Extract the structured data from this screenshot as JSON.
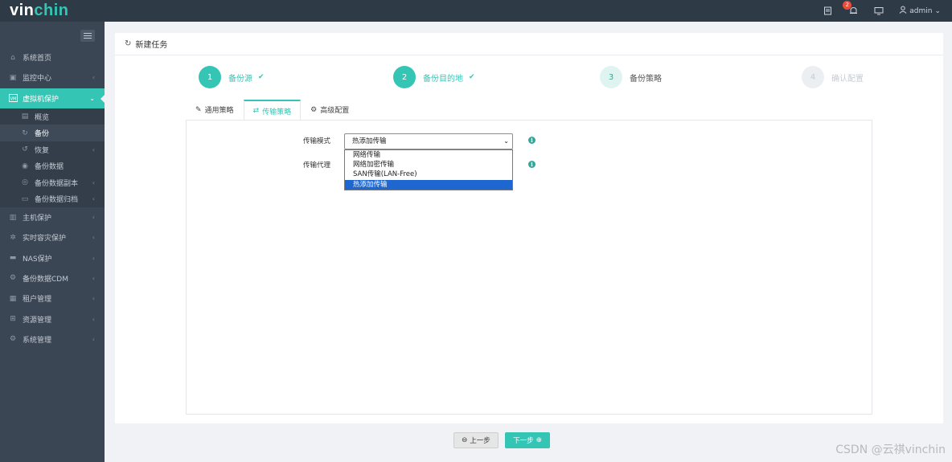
{
  "brand": {
    "part1": "vin",
    "part2": "chin"
  },
  "topbar": {
    "notification_count": "2",
    "user": "admin"
  },
  "sidebar": {
    "items": [
      {
        "label": "系统首页",
        "icon": "home-icon"
      },
      {
        "label": "监控中心",
        "icon": "monitor-icon"
      },
      {
        "label": "虚拟机保护",
        "icon": "vm-icon",
        "active": true
      },
      {
        "label": "主机保护",
        "icon": "host-icon"
      },
      {
        "label": "实时容灾保护",
        "icon": "replication-icon"
      },
      {
        "label": "NAS保护",
        "icon": "nas-icon"
      },
      {
        "label": "备份数据CDM",
        "icon": "cdm-icon"
      },
      {
        "label": "租户管理",
        "icon": "tenant-icon"
      },
      {
        "label": "资源管理",
        "icon": "resource-icon"
      },
      {
        "label": "系统管理",
        "icon": "settings-icon"
      }
    ],
    "subitems": [
      {
        "label": "概览",
        "icon": "overview-icon"
      },
      {
        "label": "备份",
        "icon": "backup-icon",
        "current": true
      },
      {
        "label": "恢复",
        "icon": "restore-icon"
      },
      {
        "label": "备份数据",
        "icon": "backup-data-icon"
      },
      {
        "label": "备份数据副本",
        "icon": "backup-copy-icon"
      },
      {
        "label": "备份数据归档",
        "icon": "archive-icon"
      }
    ]
  },
  "panel": {
    "title": "新建任务"
  },
  "steps": [
    {
      "num": "1",
      "label": "备份源",
      "state": "done"
    },
    {
      "num": "2",
      "label": "备份目的地",
      "state": "done"
    },
    {
      "num": "3",
      "label": "备份策略",
      "state": "current"
    },
    {
      "num": "4",
      "label": "确认配置",
      "state": "pending"
    }
  ],
  "tabs": [
    {
      "label": "通用策略",
      "icon": "edit-icon"
    },
    {
      "label": "传输策略",
      "icon": "transfer-icon",
      "active": true
    },
    {
      "label": "高级配置",
      "icon": "gear-icon"
    }
  ],
  "form": {
    "transfer_mode_label": "传输模式",
    "transfer_mode_value": "热添加传输",
    "transfer_proxy_label": "传输代理",
    "options": [
      "网络传输",
      "网络加密传输",
      "SAN传输(LAN-Free)",
      "热添加传输"
    ]
  },
  "buttons": {
    "prev": "上一步",
    "next": "下一步"
  },
  "watermark": "CSDN @云祺vinchin",
  "colors": {
    "accent": "#35c5b5",
    "sidebar": "#3b4654",
    "topbar": "#2f3a47",
    "selected_option": "#1e66d0"
  }
}
